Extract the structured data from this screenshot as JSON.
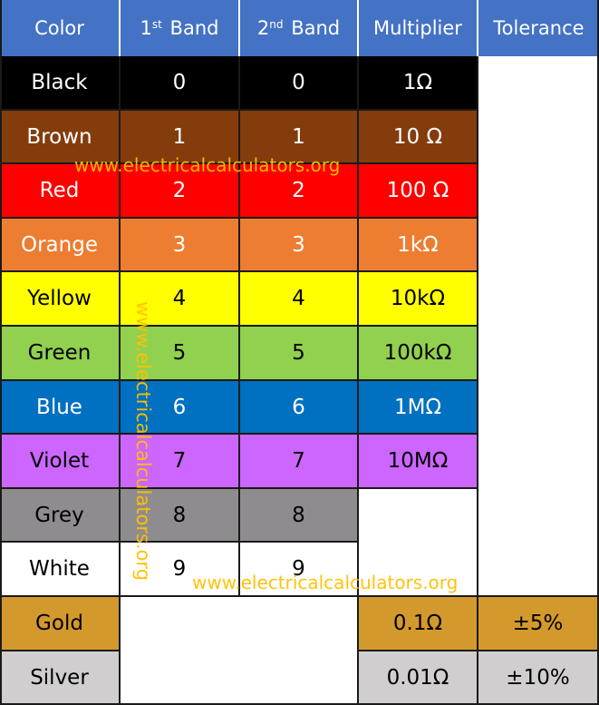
{
  "header": {
    "color": "Color",
    "band1": {
      "num": "1",
      "sup": "st",
      "label": "Band"
    },
    "band2": {
      "num": "2",
      "sup": "nd",
      "label": "Band"
    },
    "multiplier": "Multiplier",
    "tolerance": "Tolerance"
  },
  "colors": {
    "header_bg": "#4472c4"
  },
  "rows": [
    {
      "color": "Black",
      "band1": "0",
      "band2": "0",
      "multiplier": "1Ω",
      "tolerance": "",
      "bg": "#000000",
      "fg": "#ffffff"
    },
    {
      "color": "Brown",
      "band1": "1",
      "band2": "1",
      "multiplier": "10 Ω",
      "tolerance": "",
      "bg": "#843c0c",
      "fg": "#ffffff"
    },
    {
      "color": "Red",
      "band1": "2",
      "band2": "2",
      "multiplier": "100 Ω",
      "tolerance": "",
      "bg": "#ff0000",
      "fg": "#ffffff"
    },
    {
      "color": "Orange",
      "band1": "3",
      "band2": "3",
      "multiplier": "1kΩ",
      "tolerance": "",
      "bg": "#ed7d31",
      "fg": "#ffffff"
    },
    {
      "color": "Yellow",
      "band1": "4",
      "band2": "4",
      "multiplier": "10kΩ",
      "tolerance": "",
      "bg": "#ffff00",
      "fg": "#000000"
    },
    {
      "color": "Green",
      "band1": "5",
      "band2": "5",
      "multiplier": "100kΩ",
      "tolerance": "",
      "bg": "#92d050",
      "fg": "#000000"
    },
    {
      "color": "Blue",
      "band1": "6",
      "band2": "6",
      "multiplier": "1MΩ",
      "tolerance": "",
      "bg": "#0070c0",
      "fg": "#ffffff"
    },
    {
      "color": "Violet",
      "band1": "7",
      "band2": "7",
      "multiplier": "10MΩ",
      "tolerance": "",
      "bg": "#cc66ff",
      "fg": "#000000"
    },
    {
      "color": "Grey",
      "band1": "8",
      "band2": "8",
      "multiplier": "",
      "tolerance": "",
      "bg": "#8e8c8f",
      "fg": "#000000"
    },
    {
      "color": "White",
      "band1": "9",
      "band2": "9",
      "multiplier": "",
      "tolerance": "",
      "bg": "#ffffff",
      "fg": "#000000"
    },
    {
      "color": "Gold",
      "band1": "",
      "band2": "",
      "multiplier": "0.1Ω",
      "tolerance": "±5%",
      "bg": "#d4992c",
      "fg": "#000000"
    },
    {
      "color": "Silver",
      "band1": "",
      "band2": "",
      "multiplier": "0.01Ω",
      "tolerance": "±10%",
      "bg": "#d0cece",
      "fg": "#000000"
    }
  ],
  "watermark": "www.electricalcalculators.org",
  "watermark_color": "#ffc000"
}
